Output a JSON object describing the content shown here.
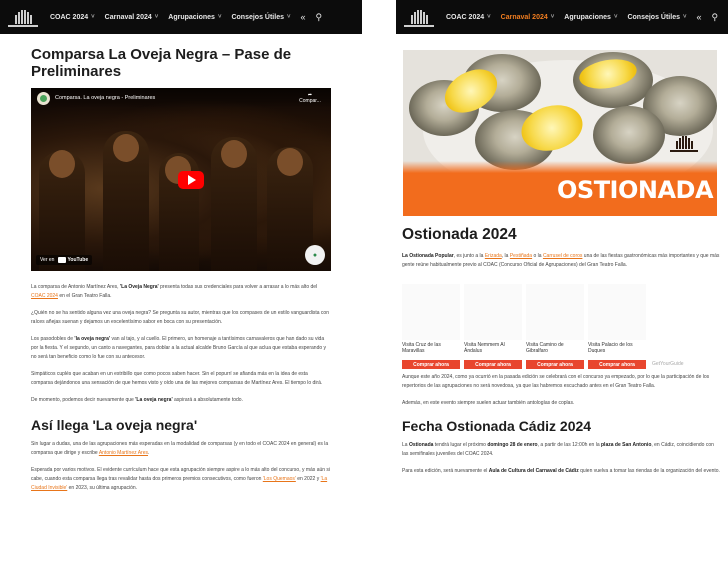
{
  "nav": {
    "items": [
      {
        "label": "COAC 2024",
        "active": false,
        "has_dropdown": true
      },
      {
        "label": "Carnaval 2024",
        "active": false,
        "has_dropdown": true
      },
      {
        "label": "Agrupaciones",
        "active": false,
        "has_dropdown": true
      },
      {
        "label": "Consejos Útiles",
        "active": false,
        "has_dropdown": true
      }
    ],
    "right_items": [
      {
        "label": "COAC 2024",
        "active": false,
        "has_dropdown": true
      },
      {
        "label": "Carnaval 2024",
        "active": true,
        "has_dropdown": true
      },
      {
        "label": "Agrupaciones",
        "active": false,
        "has_dropdown": true
      },
      {
        "label": "Consejos Útiles",
        "active": false,
        "has_dropdown": true
      }
    ],
    "accent_color": "#f07d20"
  },
  "left": {
    "title": "Comparsa La Oveja Negra – Pase de Preliminares",
    "video": {
      "title": "Comparsa. La oveja negra - Preliminares",
      "share_label": "Compar...",
      "watch_on": "Ver en",
      "platform": "YouTube"
    },
    "p1": {
      "a": "La comparsa de Antonio Martínez Ares, ",
      "b": "'La Oveja Negra'",
      "c": " presenta todas sus credenciales para volver a arrasar a lo más alto del ",
      "link": "COAC 2024",
      "d": " en el Gran Teatro Falla."
    },
    "p2": "¿Quién no se ha sentido alguna vez una oveja negra? Se pregunta su autor, mientras que los compases de un estilo vanguardista con raíces añejas suenan y dejamos un excelentísimo sabor en boca con su presentación.",
    "p3": {
      "a": "Los pasodobles de ",
      "b": "'la oveja negra'",
      "c": " van al tajo, y al cuello. El primero, un homenaje a tantísimos carnavaleros que han dado su vida por la fiesta. Y el segundo, un canto a navegantes, para doblar a la actual alcalde Bruno García al que aclua que estaba esperando y no será tan beneficio como lo fue con su antecesor."
    },
    "p4": "Simpáticos cuplés que acaban en un estribillo que como pocos saben hacer. Sin el popurrí se afianda más en la idea de esta comparsa dejándonos una sensación de que hemos visto y oído una de las mejores comparsas de Martínez Ares. El tiempo lo dirá.",
    "p5": {
      "a": "De momento, podemos decir nuevamente que ",
      "b": "'La oveja negra'",
      "c": " aspirará a absolutamente todo."
    },
    "h2": "Así llega 'La oveja negra'",
    "p6": {
      "a": "Sin lugar a dudas, una de las agrupaciones más esperadas en la modalidad de comparsas (y en todo el COAC 2024 en general) es la comparsa que dirige y escribe ",
      "link": "Antonio Martínez Ares",
      "c": "."
    },
    "p7": {
      "a": "Esperada por varios motivos. El evidente currículum hace que esta agrupación siempre aspire a lo más alto del concurso, y más aún si cabe, cuando esta comparsa llega tras revalidar hasta dos primeros premios consecutivos, como fueron ",
      "link1": "'Los Quemaos'",
      "b": " en 2022 y ",
      "link2": "'La Ciudad Invisible'",
      "c": " en 2023, su última agrupación."
    }
  },
  "right": {
    "hero_title": "OSTIONADA",
    "title": "Ostionada 2024",
    "p1": {
      "b": "La Ostionada Popular",
      "a": ", es junto a la ",
      "link1": "Erizada",
      "c": ", la ",
      "link2": "Pestiñada",
      "d": " o la ",
      "link3": "Carrusel de coros",
      "e": " una de las fiestas gastronómicas más importantes y que más gente reúne habitualmente previo al COAC (Concurso Oficial de Agrupaciones) del Gran Teatro Falla."
    },
    "products": [
      {
        "name": "Visita Cruz de las Maravillas",
        "button": "Comprar ahora"
      },
      {
        "name": "Visita Nemmem Al Ándalus",
        "button": "Comprar ahora"
      },
      {
        "name": "Visita Camino de Gibralfaro",
        "button": "Comprar ahora"
      },
      {
        "name": "Visita Palacio de los Duques",
        "button": "Comprar ahora"
      }
    ],
    "product_note": "GetYourGuide",
    "p2": "Aunque este año 2024, como ya ocurrió en la pasada edición se celebrará con el concurso ya empezado, por lo que la participación de los repertorios de las agrupaciones no será novedosa, ya que las habremos escuchado antes en el Gran Teatro Falla.",
    "p3": "Además, en este evento siempre suelen actuar también antologías de coplas.",
    "h2": "Fecha Ostionada Cádiz 2024",
    "p4": {
      "a": "La ",
      "b1": "Ostionada",
      "c": " tendrá lugar el próximo ",
      "b2": "domingo 28 de enero",
      "d": ", a partir de las 12:00h en la ",
      "b3": "plaza de San Antonio",
      "e": ", en Cádiz, coincidiendo con las semifinales juveniles del COAC 2024."
    },
    "p5": {
      "a": "Para esta edición, será nuevamente el ",
      "b": "Aula de Cultura del Carnaval de Cádiz",
      "c": " quien vuelva a tomar las riendas de la organización del evento."
    }
  }
}
